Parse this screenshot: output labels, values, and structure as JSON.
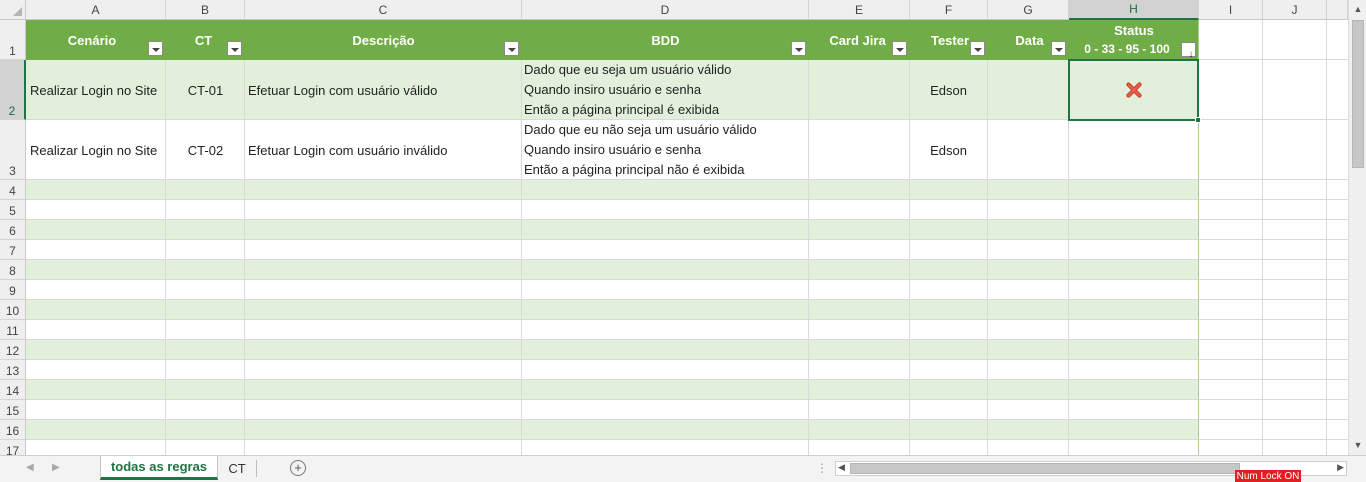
{
  "columns": [
    "A",
    "B",
    "C",
    "D",
    "E",
    "F",
    "G",
    "H",
    "I",
    "J"
  ],
  "selected_column": "H",
  "selected_row": "2",
  "row_numbers": [
    "1",
    "2",
    "3",
    "4",
    "5",
    "6",
    "7",
    "8",
    "9",
    "10",
    "11",
    "12",
    "13",
    "14",
    "15",
    "16",
    "17"
  ],
  "table_headers": {
    "cenario": "Cenário",
    "ct": "CT",
    "descricao": "Descrição",
    "bdd": "BDD",
    "card_jira": "Card Jira",
    "tester": "Tester",
    "data": "Data",
    "status_title": "Status",
    "status_scale": "0 - 33 - 95 - 100"
  },
  "rows": [
    {
      "cenario": "Realizar Login no Site",
      "ct": "CT-01",
      "descricao": "Efetuar Login com usuário válido",
      "bdd": [
        "Dado que eu seja um usuário válido",
        "Quando insiro usuário e senha",
        "Então a página principal é exibida"
      ],
      "card_jira": "",
      "tester": "Edson",
      "data": "",
      "status_icon": "red-x-icon"
    },
    {
      "cenario": "Realizar Login no Site",
      "ct": "CT-02",
      "descricao": "Efetuar Login com usuário inválido",
      "bdd": [
        "Dado que eu não seja um usuário válido",
        "Quando insiro usuário e senha",
        "Então a página principal não é exibida"
      ],
      "card_jira": "",
      "tester": "Edson",
      "data": "",
      "status_icon": ""
    }
  ],
  "sheet_tabs": [
    {
      "label": "todas as regras",
      "active": true
    },
    {
      "label": "CT",
      "active": false
    }
  ],
  "status_indicator": "Num Lock ON",
  "colors": {
    "header_green": "#70ad47",
    "band_green": "#e2efda",
    "accent": "#217346",
    "status_red": "#e0503c"
  }
}
